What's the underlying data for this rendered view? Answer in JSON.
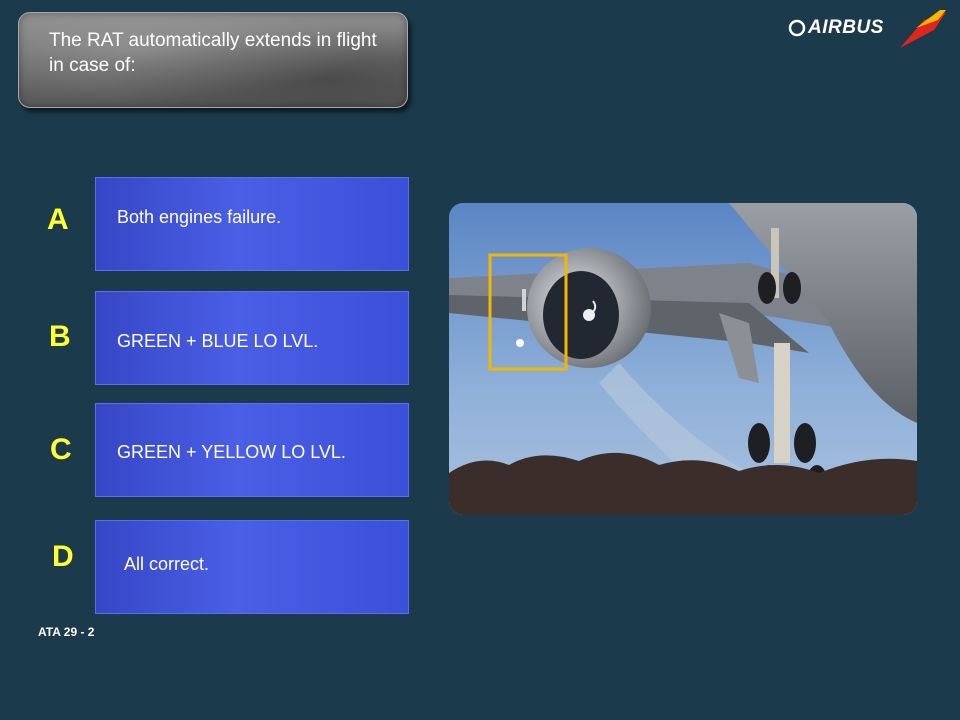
{
  "question": {
    "text": "The RAT automatically extends in flight in case of:"
  },
  "logo": {
    "brand_text": "AIRBUS"
  },
  "options": [
    {
      "letter": "A",
      "text": "Both engines failure."
    },
    {
      "letter": "B",
      "text": "GREEN + BLUE LO LVL."
    },
    {
      "letter": "C",
      "text": "GREEN + YELLOW LO LVL."
    },
    {
      "letter": "D",
      "text": "All correct."
    }
  ],
  "photo": {
    "subject": "airplane-engine-landing-gear-photo",
    "highlight_color": "#f2b705"
  },
  "footer": {
    "text": "ATA 29 - 2"
  },
  "colors": {
    "background": "#1b3a4b",
    "option_fill": "#4a5ee6",
    "letter": "#ffff33",
    "logo_red": "#e1251b",
    "logo_yellow": "#f5b800"
  }
}
